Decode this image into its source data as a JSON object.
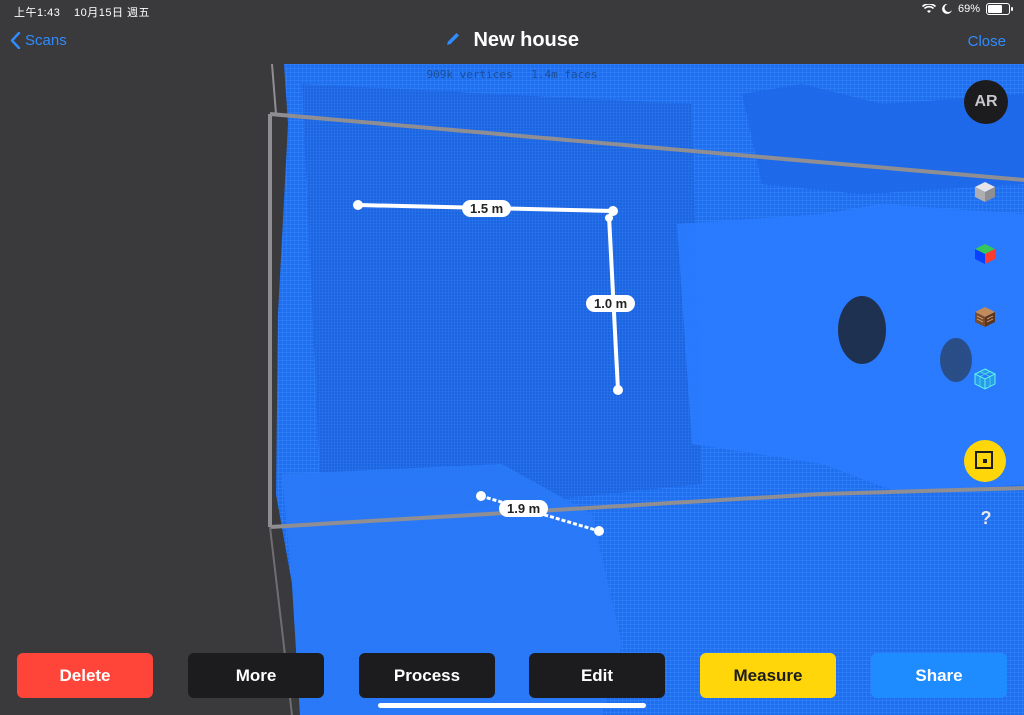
{
  "status_bar": {
    "time": "上午1:43",
    "date": "10月15日 週五",
    "battery": "69%",
    "battery_level": 0.69
  },
  "nav": {
    "back_label": "Scans",
    "title": "New house",
    "close_label": "Close"
  },
  "stats": {
    "vertices": "909k vertices",
    "faces": "1.4m faces"
  },
  "side_tools": {
    "ar_label": "AR",
    "help_label": "?",
    "icons": [
      "solid-cube-icon",
      "color-cube-icon",
      "texture-cube-icon",
      "wireframe-cube-icon",
      "frame-select-icon",
      "help-icon"
    ]
  },
  "measurements": [
    {
      "label": "1.5 m"
    },
    {
      "label": "1.0 m"
    },
    {
      "label": "1.9 m"
    }
  ],
  "toolbar": {
    "delete": "Delete",
    "more": "More",
    "process": "Process",
    "edit": "Edit",
    "measure": "Measure",
    "share": "Share"
  },
  "colors": {
    "accent": "#2f8cff",
    "delete": "#ff453a",
    "measure": "#ffd60a",
    "share": "#1e8cff",
    "mesh": "#1a6cff",
    "dark_button": "#1c1c1e"
  }
}
